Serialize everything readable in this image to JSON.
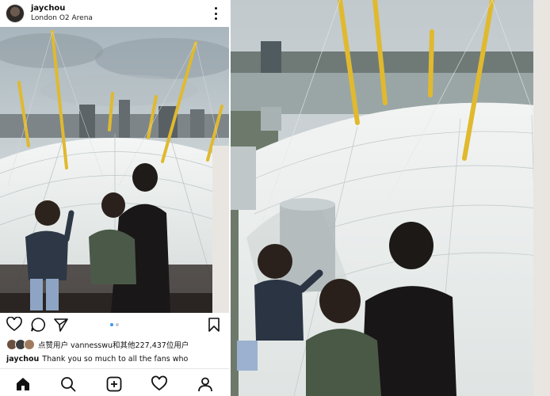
{
  "post": {
    "username": "jaychou",
    "location": "London O2 Arena",
    "likes_text": "点赞用户 vannesswu和其他227,437位用户",
    "caption_user": "jaychou",
    "caption_text": "Thank you so much to all the fans who"
  },
  "actions": [
    "heart-icon",
    "comment-icon",
    "share-icon",
    "bookmark-icon"
  ],
  "nav": [
    "home-icon",
    "search-icon",
    "new-post-icon",
    "activity-icon",
    "profile-icon"
  ],
  "carousel": {
    "count": 2,
    "active": 1
  },
  "colors": {
    "accent": "#3897f0",
    "dome": "#eef1f0",
    "masts": "#e6c23a",
    "sky": "#c9d3d8"
  }
}
